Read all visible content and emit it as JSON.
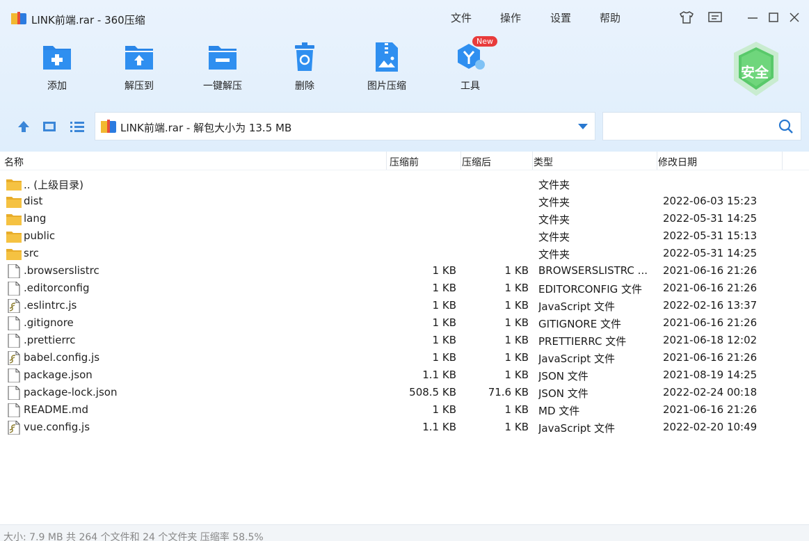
{
  "window": {
    "title": "LINK前端.rar - 360压缩"
  },
  "menu": [
    "文件",
    "操作",
    "设置",
    "帮助"
  ],
  "toolbar": {
    "items": [
      {
        "label": "添加",
        "icon": "add-icon"
      },
      {
        "label": "解压到",
        "icon": "extract-to-icon"
      },
      {
        "label": "一键解压",
        "icon": "one-click-extract-icon"
      },
      {
        "label": "删除",
        "icon": "delete-icon"
      },
      {
        "label": "图片压缩",
        "icon": "image-compress-icon"
      },
      {
        "label": "工具",
        "icon": "tools-icon"
      }
    ],
    "new_badge": "New",
    "safe_label": "安全"
  },
  "address": {
    "text": "LINK前端.rar - 解包大小为 13.5 MB"
  },
  "search": {
    "placeholder": ""
  },
  "columns": [
    "名称",
    "压缩前",
    "压缩后",
    "类型",
    "修改日期"
  ],
  "files": [
    {
      "name": ".. (上级目录)",
      "original": "",
      "compressed": "",
      "type": "文件夹",
      "date": "",
      "icon": "folder-icon"
    },
    {
      "name": "dist",
      "original": "",
      "compressed": "",
      "type": "文件夹",
      "date": "2022-06-03 15:23",
      "icon": "folder-icon"
    },
    {
      "name": "lang",
      "original": "",
      "compressed": "",
      "type": "文件夹",
      "date": "2022-05-31 14:25",
      "icon": "folder-icon"
    },
    {
      "name": "public",
      "original": "",
      "compressed": "",
      "type": "文件夹",
      "date": "2022-05-31 15:13",
      "icon": "folder-icon"
    },
    {
      "name": "src",
      "original": "",
      "compressed": "",
      "type": "文件夹",
      "date": "2022-05-31 14:25",
      "icon": "folder-icon"
    },
    {
      "name": ".browserslistrc",
      "original": "1 KB",
      "compressed": "1 KB",
      "type": "BROWSERSLISTRC ...",
      "date": "2021-06-16 21:26",
      "icon": "file-icon"
    },
    {
      "name": ".editorconfig",
      "original": "1 KB",
      "compressed": "1 KB",
      "type": "EDITORCONFIG 文件",
      "date": "2021-06-16 21:26",
      "icon": "file-icon"
    },
    {
      "name": ".eslintrc.js",
      "original": "1 KB",
      "compressed": "1 KB",
      "type": "JavaScript 文件",
      "date": "2022-02-16 13:37",
      "icon": "script-file-icon"
    },
    {
      "name": ".gitignore",
      "original": "1 KB",
      "compressed": "1 KB",
      "type": "GITIGNORE 文件",
      "date": "2021-06-16 21:26",
      "icon": "file-icon"
    },
    {
      "name": ".prettierrc",
      "original": "1 KB",
      "compressed": "1 KB",
      "type": "PRETTIERRC 文件",
      "date": "2021-06-18 12:02",
      "icon": "file-icon"
    },
    {
      "name": "babel.config.js",
      "original": "1 KB",
      "compressed": "1 KB",
      "type": "JavaScript 文件",
      "date": "2021-06-16 21:26",
      "icon": "script-file-icon"
    },
    {
      "name": "package.json",
      "original": "1.1 KB",
      "compressed": "1 KB",
      "type": "JSON 文件",
      "date": "2021-08-19 14:25",
      "icon": "file-icon"
    },
    {
      "name": "package-lock.json",
      "original": "508.5 KB",
      "compressed": "71.6 KB",
      "type": "JSON 文件",
      "date": "2022-02-24 00:18",
      "icon": "file-icon"
    },
    {
      "name": "README.md",
      "original": "1 KB",
      "compressed": "1 KB",
      "type": "MD 文件",
      "date": "2021-06-16 21:26",
      "icon": "file-icon"
    },
    {
      "name": "vue.config.js",
      "original": "1.1 KB",
      "compressed": "1 KB",
      "type": "JavaScript 文件",
      "date": "2022-02-20 10:49",
      "icon": "script-file-icon"
    }
  ],
  "status": {
    "text": "大小: 7.9 MB 共 264 个文件和 24 个文件夹 压缩率 58.5%"
  },
  "colors": {
    "accent": "#2878d0",
    "toolbar_bg": "#e6f1fc",
    "folder": "#f5c242",
    "safe_green": "#59c96a",
    "badge_red": "#e83b3b"
  }
}
